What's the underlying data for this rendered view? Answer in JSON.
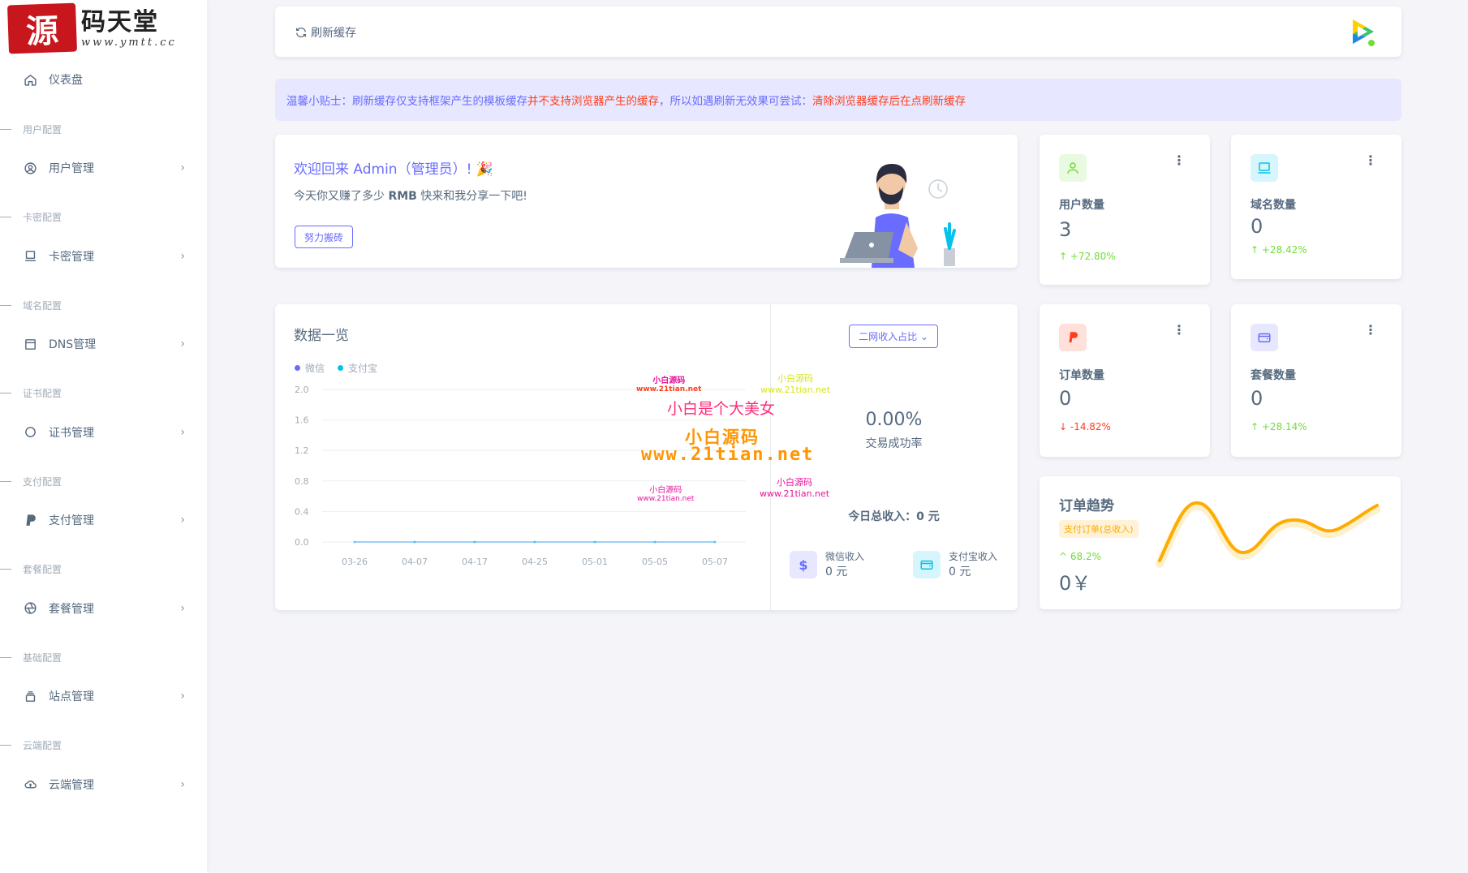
{
  "logo": {
    "mark": "源",
    "text": "码天堂",
    "url": "www.ymtt.cc"
  },
  "sidebar": {
    "dashboard": "仪表盘",
    "sections": [
      {
        "header": "用户配置",
        "item": "用户管理",
        "icon": "user-circle-icon"
      },
      {
        "header": "卡密配置",
        "item": "卡密管理",
        "icon": "card-icon"
      },
      {
        "header": "域名配置",
        "item": "DNS管理",
        "icon": "window-icon"
      },
      {
        "header": "证书配置",
        "item": "证书管理",
        "icon": "circle-icon"
      },
      {
        "header": "支付配置",
        "item": "支付管理",
        "icon": "paypal-icon"
      },
      {
        "header": "套餐配置",
        "item": "套餐管理",
        "icon": "aperture-icon"
      },
      {
        "header": "基础配置",
        "item": "站点管理",
        "icon": "layers-icon"
      },
      {
        "header": "云端配置",
        "item": "云端管理",
        "icon": "cloud-upload-icon"
      }
    ]
  },
  "topbar": {
    "refresh_label": "刷新缓存"
  },
  "tip": {
    "prefix": "温馨小贴士：刷新缓存仅支持框架产生的模板缓存",
    "red1": "并不支持浏览器产生的缓存",
    "middle": "，所以如遇刷新无效果可尝试：",
    "red2": "清除浏览器缓存后在点刷新缓存"
  },
  "welcome": {
    "title": "欢迎回来 Admin（管理员）! 🎉",
    "sub_prefix": "今天你又赚了多少 ",
    "sub_bold": "RMB",
    "sub_suffix": " 快来和我分享一下吧!",
    "button": "努力搬砖"
  },
  "stats": [
    {
      "label": "用户数量",
      "value": "3",
      "change": "+72.80%",
      "dir": "up",
      "color": "#71dd37",
      "bg": "#e8fadf"
    },
    {
      "label": "域名数量",
      "value": "0",
      "change": "+28.42%",
      "dir": "up",
      "color": "#03c3ec",
      "bg": "#d7f5fc"
    },
    {
      "label": "订单数量",
      "value": "0",
      "change": "-14.82%",
      "dir": "down",
      "color": "#ff3e1d",
      "bg": "#ffe0db"
    },
    {
      "label": "套餐数量",
      "value": "0",
      "change": "+28.14%",
      "dir": "up",
      "color": "#696cff",
      "bg": "#e7e7ff"
    }
  ],
  "overview": {
    "title": "数据一览",
    "dropdown": "二网收入占比 ⌄",
    "rate": "0.00%",
    "rate_label": "交易成功率",
    "today": "今日总收入：0 元",
    "wechat_label": "微信收入",
    "wechat_value": "0 元",
    "alipay_label": "支付宝收入",
    "alipay_value": "0 元"
  },
  "chart_data": {
    "type": "line",
    "x": [
      "03-26",
      "04-07",
      "04-17",
      "04-25",
      "05-01",
      "05-05",
      "05-07"
    ],
    "series": [
      {
        "name": "微信",
        "values": [
          0,
          0,
          0,
          0,
          0,
          0,
          0
        ],
        "color": "#696cff"
      },
      {
        "name": "支付宝",
        "values": [
          0,
          0,
          0,
          0,
          0,
          0,
          0
        ],
        "color": "#03c3ec"
      }
    ],
    "yticks": [
      "2.0",
      "1.6",
      "1.2",
      "0.8",
      "0.4",
      "0.0"
    ],
    "ylim": [
      0,
      2.0
    ],
    "grid": true,
    "legend": "top-left"
  },
  "watermark": {
    "line1": "小白源码",
    "line2": "www.21tian.net",
    "main": "小白是个大美女",
    "brand": "小白源码",
    "url": "www.21tian.net"
  },
  "trend": {
    "title": "订单趋势",
    "badge": "支付订单(总收入)",
    "change": "68.2%",
    "value": "0￥"
  }
}
